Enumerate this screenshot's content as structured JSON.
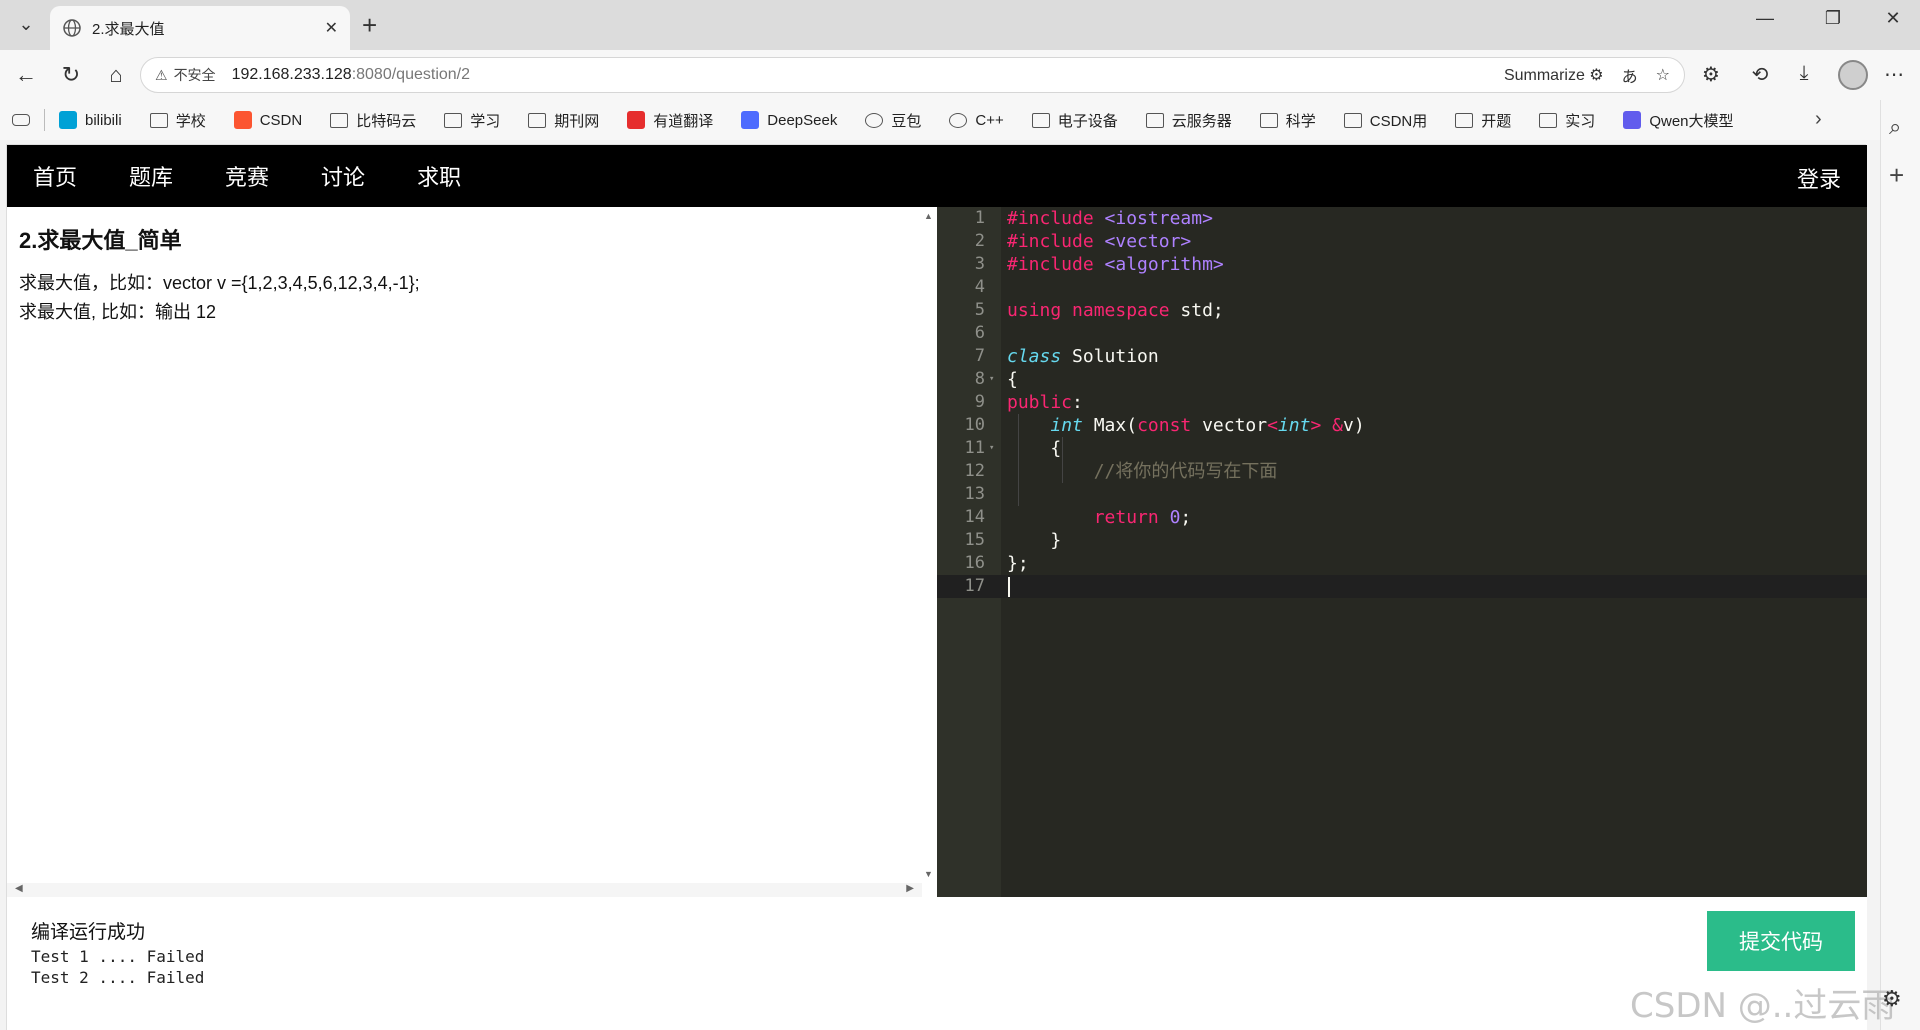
{
  "browser": {
    "tab_title": "2.求最大值",
    "address": {
      "insecure_label": "不安全",
      "host": "192.168.233.128",
      "path": ":8080/question/2",
      "summarize_label": "Summarize"
    },
    "bookmarks": [
      {
        "label": "bilibili",
        "icon": "bilibili-icon",
        "color": "#00a1d6"
      },
      {
        "label": "学校",
        "icon": "folder-icon"
      },
      {
        "label": "CSDN",
        "icon": "csdn-icon",
        "color": "#fc5531"
      },
      {
        "label": "比特码云",
        "icon": "folder-icon"
      },
      {
        "label": "学习",
        "icon": "folder-icon"
      },
      {
        "label": "期刊网",
        "icon": "folder-icon"
      },
      {
        "label": "有道翻译",
        "icon": "youdao-icon",
        "color": "#e62e2e"
      },
      {
        "label": "DeepSeek",
        "icon": "deepseek-icon",
        "color": "#4d6bfe"
      },
      {
        "label": "豆包",
        "icon": "doubao-icon"
      },
      {
        "label": "C++",
        "icon": "cpp-icon"
      },
      {
        "label": "电子设备",
        "icon": "folder-icon"
      },
      {
        "label": "云服务器",
        "icon": "folder-icon"
      },
      {
        "label": "科学",
        "icon": "folder-icon"
      },
      {
        "label": "CSDN用",
        "icon": "folder-icon"
      },
      {
        "label": "开题",
        "icon": "folder-icon"
      },
      {
        "label": "实习",
        "icon": "folder-icon"
      },
      {
        "label": "Qwen大模型",
        "icon": "qwen-icon",
        "color": "#615ced"
      }
    ]
  },
  "site": {
    "nav": [
      "首页",
      "题库",
      "竞赛",
      "讨论",
      "求职"
    ],
    "login": "登录"
  },
  "question": {
    "title": "2.求最大值_简单",
    "desc_line1": "求最大值，比如：vector v ={1,2,3,4,5,6,12,3,4,-1};",
    "desc_line2": "求最大值, 比如：输出 12"
  },
  "editor": {
    "line_numbers": [
      "1",
      "2",
      "3",
      "4",
      "5",
      "6",
      "7",
      "8",
      "9",
      "10",
      "11",
      "12",
      "13",
      "14",
      "15",
      "16",
      "17"
    ],
    "fold_markers": {
      "8": "▾",
      "11": "▾"
    },
    "code": {
      "l1_kw": "#include",
      "l1_lib": "<iostream>",
      "l2_kw": "#include",
      "l2_lib": "<vector>",
      "l3_kw": "#include",
      "l3_lib": "<algorithm>",
      "l5_kw1": "using",
      "l5_kw2": "namespace",
      "l5_rest": " std;",
      "l7_kw": "class",
      "l7_rest": " Solution",
      "l8": "{",
      "l9_kw": "public",
      "l9_rest": ":",
      "l10_type": "int",
      "l10_name": " Max(",
      "l10_const": "const",
      "l10_vec": " vector",
      "l10_lt": "<",
      "l10_int": "int",
      "l10_gt": ">",
      "l10_amp": " &",
      "l10_end": "v)",
      "l11": "{",
      "l12_comment": "//将你的代码写在下面",
      "l14_kw": "return",
      "l14_num": "0",
      "l14_end": ";",
      "l15": "}",
      "l16": "};"
    }
  },
  "result": {
    "status": "编译运行成功",
    "tests": [
      "Test 1 .... Failed",
      "Test 2 .... Failed"
    ],
    "submit_label": "提交代码"
  },
  "watermark": "CSDN @..过云雨",
  "colors": {
    "submit": "#2bbc8a",
    "editor_bg": "#272822",
    "keyword": "#f92672",
    "string": "#ae81ff",
    "type": "#66d9ef",
    "comment": "#75715e"
  }
}
